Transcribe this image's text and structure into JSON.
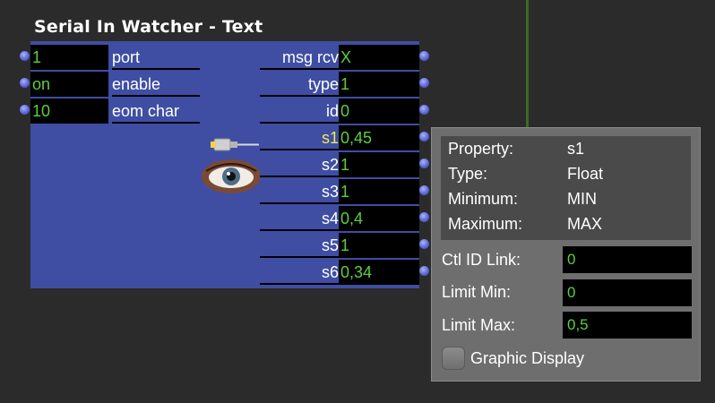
{
  "actor": {
    "title": "Serial In Watcher - Text",
    "inputs": [
      {
        "value": "1",
        "label": "port"
      },
      {
        "value": "on",
        "label": "enable"
      },
      {
        "value": "10",
        "label": "eom char"
      }
    ],
    "outputs": [
      {
        "label": "msg rcv",
        "value": "X"
      },
      {
        "label": "type",
        "value": "1"
      },
      {
        "label": "id",
        "value": "0"
      },
      {
        "label": "s1",
        "value": "0,45"
      },
      {
        "label": "s2",
        "value": "1"
      },
      {
        "label": "s3",
        "value": "1"
      },
      {
        "label": "s4",
        "value": "0,4"
      },
      {
        "label": "s5",
        "value": "1"
      },
      {
        "label": "s6",
        "value": "0,34"
      }
    ],
    "icons": [
      "serial-plug-icon",
      "eye-icon"
    ],
    "colors": {
      "body": "#3f4ea3",
      "value_text": "#5bcf3f",
      "highlight_label": "#f0ea57"
    }
  },
  "property_panel": {
    "info": [
      {
        "key": "Property:",
        "value": "s1"
      },
      {
        "key": "Type:",
        "value": "Float"
      },
      {
        "key": "Minimum:",
        "value": "MIN"
      },
      {
        "key": "Maximum:",
        "value": "MAX"
      }
    ],
    "fields": [
      {
        "label": "Ctl ID Link:",
        "value": "0"
      },
      {
        "label": "Limit Min:",
        "value": "0"
      },
      {
        "label": "Limit Max:",
        "value": "0,5"
      }
    ],
    "checkbox_label": "Graphic Display"
  }
}
